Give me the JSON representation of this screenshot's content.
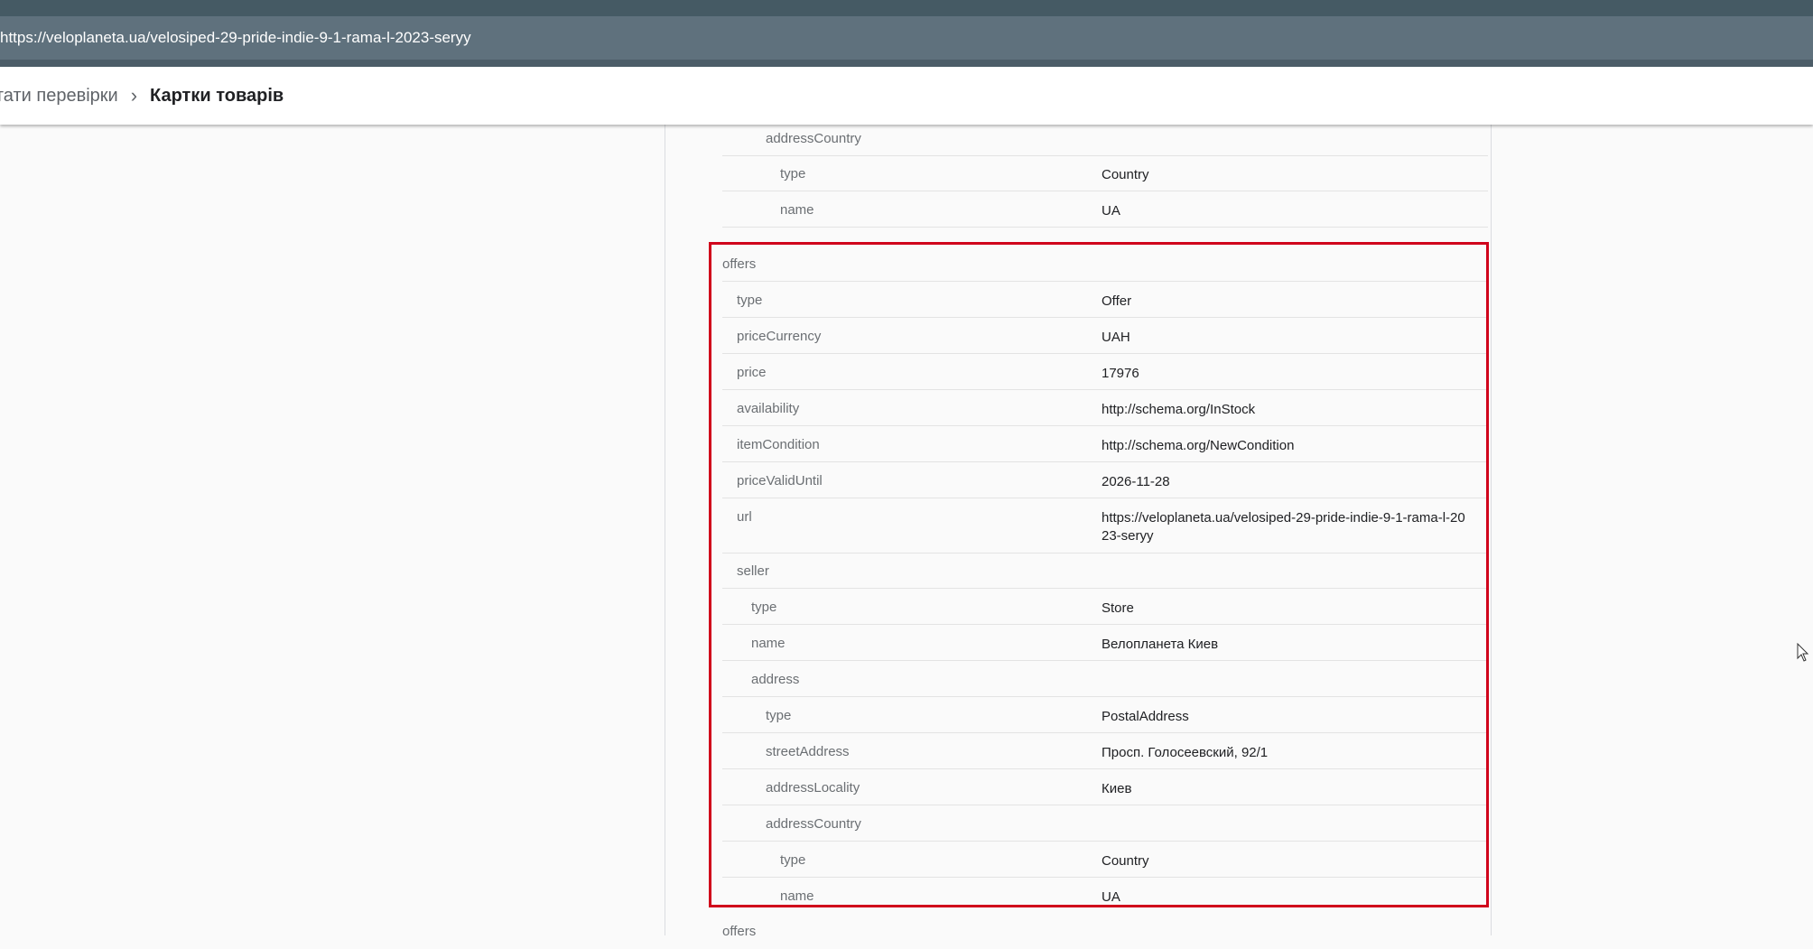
{
  "browser": {
    "url": "https://veloplaneta.ua/velosiped-29-pride-indie-9-1-rama-l-2023-seryy"
  },
  "breadcrumb": {
    "previous": "ьтати перевірки",
    "separator": "›",
    "current": "Картки товарів"
  },
  "rows_above": [
    {
      "key": "addressCountry",
      "value": ""
    },
    {
      "key": "type",
      "value": "Country"
    },
    {
      "key": "name",
      "value": "UA"
    }
  ],
  "offers_block": [
    {
      "key": "offers",
      "value": ""
    },
    {
      "key": "type",
      "value": "Offer"
    },
    {
      "key": "priceCurrency",
      "value": "UAH"
    },
    {
      "key": "price",
      "value": "17976"
    },
    {
      "key": "availability",
      "value": "http://schema.org/InStock"
    },
    {
      "key": "itemCondition",
      "value": "http://schema.org/NewCondition"
    },
    {
      "key": "priceValidUntil",
      "value": "2026-11-28"
    },
    {
      "key": "url",
      "value": "https://veloplaneta.ua/velosiped-29-pride-indie-9-1-rama-l-2023-seryy"
    },
    {
      "key": "seller",
      "value": ""
    },
    {
      "key": "type",
      "value": "Store"
    },
    {
      "key": "name",
      "value": "Велопланета Киев"
    },
    {
      "key": "address",
      "value": ""
    },
    {
      "key": "type",
      "value": "PostalAddress"
    },
    {
      "key": "streetAddress",
      "value": "Просп. Голосеевский, 92/1"
    },
    {
      "key": "addressLocality",
      "value": "Киев"
    },
    {
      "key": "addressCountry",
      "value": ""
    },
    {
      "key": "type",
      "value": "Country"
    },
    {
      "key": "name",
      "value": "UA"
    }
  ],
  "rows_below": [
    {
      "key": "offers",
      "value": ""
    }
  ],
  "colors": {
    "highlight_border": "#d0021b",
    "url_bar": "#5f717d",
    "top_strip": "#455a64"
  }
}
